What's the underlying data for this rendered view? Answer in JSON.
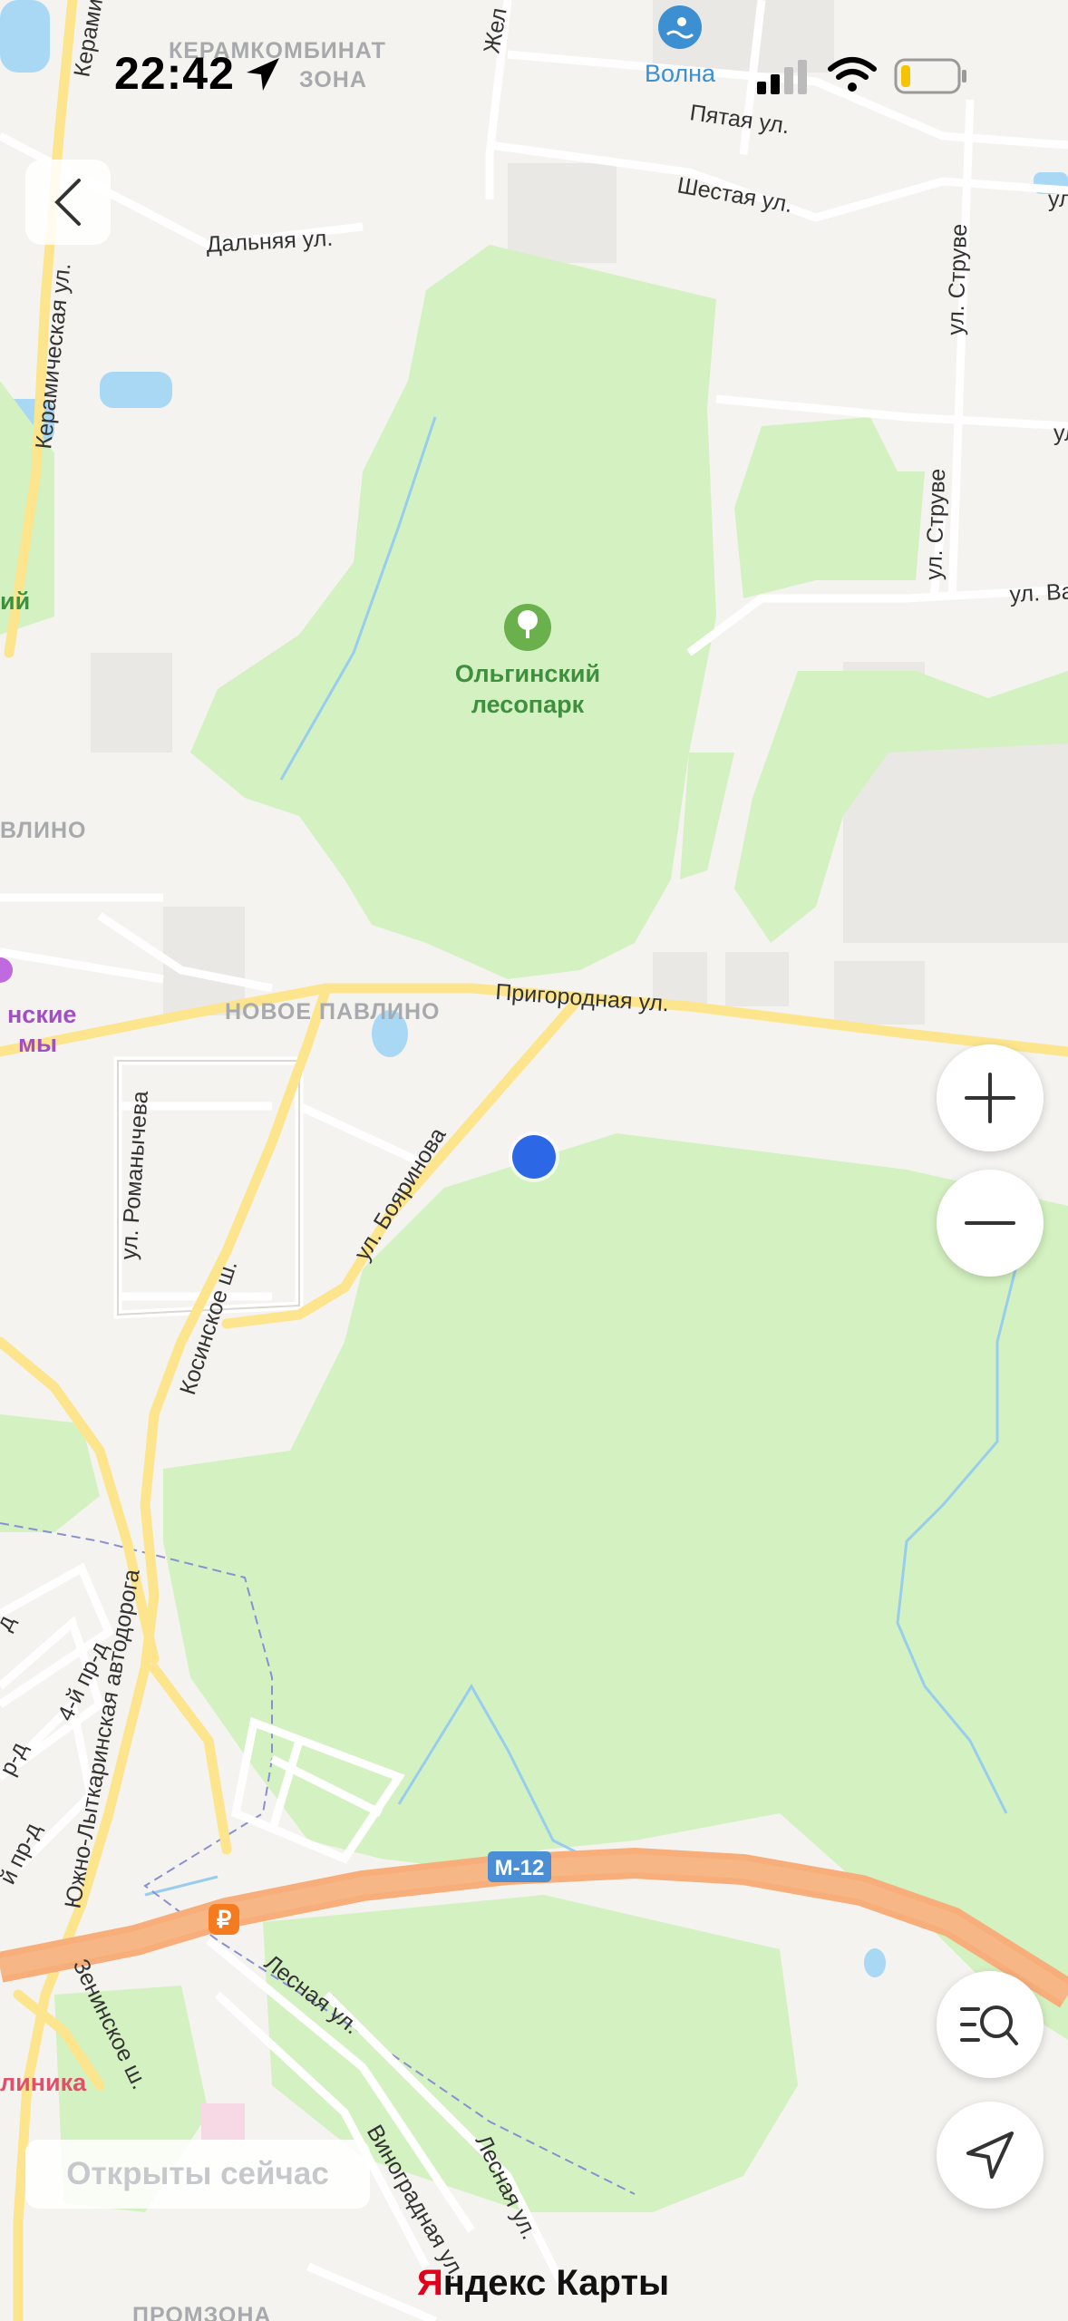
{
  "status_bar": {
    "time": "22:42",
    "icons": [
      "location-arrow-icon",
      "cellular-signal-icon",
      "wifi-icon",
      "battery-low-icon"
    ]
  },
  "map": {
    "districts": {
      "keramkombinat_1": "КЕРАМКОМБИНАТ",
      "keramkombinat_2": "ЗОНА",
      "pavlino": "ВЛИНО",
      "novoe_pavlino": "НОВОЕ ПАВЛИНО",
      "promzona": "ПРОМЗОНА"
    },
    "park": {
      "line1": "Ольгинский",
      "line2": "лесопарк",
      "icon": "tree-icon",
      "color": "#6ab04c"
    },
    "pois": {
      "volna": {
        "name": "Волна",
        "icon": "swimming-icon",
        "color": "#3c8fd1"
      },
      "purple_1": "нские",
      "purple_2": "мы",
      "green_left": "ий",
      "clinic": "линика"
    },
    "roads": {
      "keramicheskaya_top": "Керами",
      "zheleznodorozhnaya": "Жел",
      "pyataya": "Пятая ул.",
      "shestaya": "Шестая ул.",
      "ul_right_1": "ул",
      "dalnyaya": "Дальняя ул.",
      "keramicheskaya": "Керамическая ул.",
      "struve_1": "ул. Струве",
      "struve_2": "ул. Струве",
      "ul_right_2": "ул",
      "ul_va": "ул. Ва",
      "prigorodnaya": "Пригородная ул.",
      "boyarinova": "ул. Бояринова",
      "romanycheva": "ул. Романычева",
      "kosinskoe": "Косинское ш.",
      "yuzhno": "Южно-Лыткаринская автодорога",
      "fourth_pr": "4-й пр-д",
      "pr_a": "д",
      "pr_b": "р-д",
      "pr_c": "й пр-д",
      "m12": "М-12",
      "zeninskoe": "Зенинское ш.",
      "lesnaya_1": "Лесная ул.",
      "lesnaya_2": "Лесная ул.",
      "vinogradnaya": "Виноградная ул."
    },
    "toll_badge": "₽",
    "colors": {
      "forest": "#d4f1c1",
      "forest_dark": "#bfe7a8",
      "road_major": "#fce58d",
      "highway": "#f7ae7a",
      "water": "#a9d8f5",
      "user_dot": "#2c68e6"
    }
  },
  "controls": {
    "back": "back-chevron-icon",
    "zoom_in": "plus-icon",
    "zoom_out": "minus-icon",
    "search": "search-list-icon",
    "locate": "navigation-arrow-icon"
  },
  "filter_chip": "Открыты сейчас",
  "brand": {
    "first": "Я",
    "rest": "ндекс Карты"
  }
}
